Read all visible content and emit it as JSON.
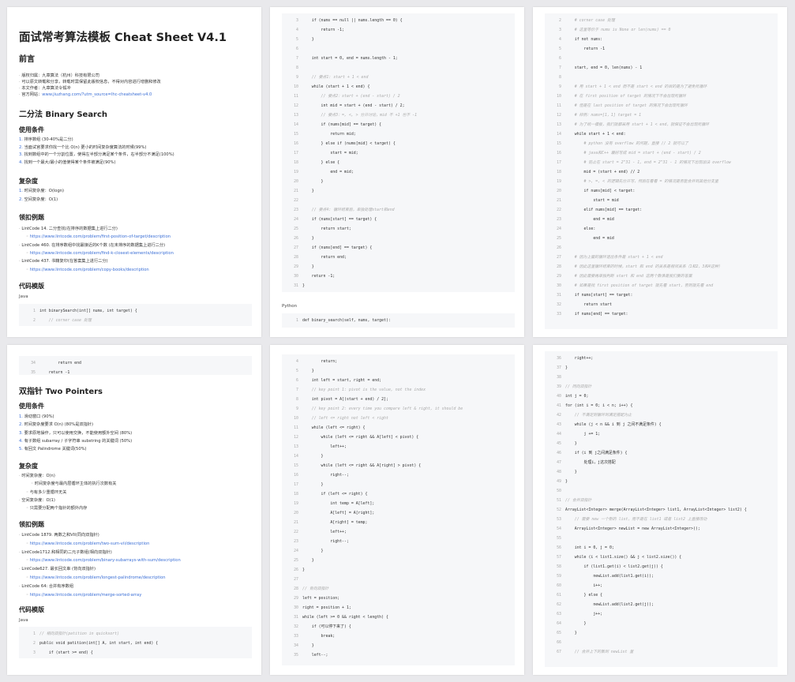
{
  "p1": {
    "title": "面试常考算法模板 Cheat Sheet V4.1",
    "preface": {
      "heading": "前言",
      "items": [
        {
          "t": "版权归属：九章算法（杭州）科技有限公司"
        },
        {
          "t": "可以原文转载和分享，转载时需保留此版权信息，不得对内容进行增删和修改"
        },
        {
          "t": "本文作者：九章算法令狐冲"
        },
        {
          "t": "官方网站：",
          "u": "www.jiuzhang.com/?utm_source=lhc-cheatsheet-v4.0"
        }
      ]
    },
    "section": "二分法 Binary Search",
    "conditions": {
      "heading": "使用条件",
      "items": [
        {
          "n": "1.",
          "t": "排序数组 (30-40%是二分)"
        },
        {
          "n": "2.",
          "t": "当面试官要求你找一个比 O(n) 更小的时间复杂度算法的时候(99%)"
        },
        {
          "n": "3.",
          "t": "找到数组中的一个分割位置，使得左半部分满足某个条件，右半部分不满足(100%)"
        },
        {
          "n": "4.",
          "t": "找到一个最大/最小的值使得某个条件被满足(90%)"
        }
      ]
    },
    "complexity": {
      "heading": "复杂度",
      "items": [
        {
          "n": "1.",
          "t": "时间复杂度：O(logn)"
        },
        {
          "n": "2.",
          "t": "空间复杂度：O(1)"
        }
      ]
    },
    "examples": {
      "heading": "领扣例题",
      "items": [
        {
          "t": "LintCode 14. 二分查找(在排序的数据集上进行二分)",
          "lvl": 0
        },
        {
          "u": "https://www.lintcode.com/problem/first-position-of-target/description",
          "lvl": 1
        },
        {
          "t": "LintCode 460. 在排序数组中找最接近的K个数 (在未排序的数据集上进行二分)",
          "lvl": 0
        },
        {
          "u": "https://www.lintcode.com/problem/find-k-closest-elements/description",
          "lvl": 1
        },
        {
          "t": "LintCode 437. 书籍复印(在答案集上进行二分)",
          "lvl": 0
        },
        {
          "u": "https://www.lintcode.com/problem/copy-books/description",
          "lvl": 1
        }
      ]
    },
    "template_heading": "代码模版",
    "lang": "Java",
    "code": [
      {
        "n": "1",
        "t": "int binarySearch(int[] nums, int target) {"
      },
      {
        "n": "2",
        "t": "    // corner case 处理",
        "c": true
      }
    ]
  },
  "p2": {
    "code": [
      {
        "n": "3",
        "t": "    if (nums == null || nums.length == 0) {"
      },
      {
        "n": "4",
        "t": "        return -1;"
      },
      {
        "n": "5",
        "t": "    }"
      },
      {
        "n": "6",
        "t": ""
      },
      {
        "n": "7",
        "t": "    int start = 0, end = nums.length - 1;"
      },
      {
        "n": "8",
        "t": ""
      },
      {
        "n": "9",
        "t": "    // 要点1: start + 1 < end",
        "c": true
      },
      {
        "n": "10",
        "t": "    while (start + 1 < end) {"
      },
      {
        "n": "11",
        "t": "        // 要点2：start + (end - start) / 2",
        "c": true
      },
      {
        "n": "12",
        "t": "        int mid = start + (end - start) / 2;"
      },
      {
        "n": "13",
        "t": "        // 要点3：=, <, > 分开讨论，mid 不 +1 也不 -1",
        "c": true
      },
      {
        "n": "14",
        "t": "        if (nums[mid] == target) {"
      },
      {
        "n": "15",
        "t": "            return mid;"
      },
      {
        "n": "16",
        "t": "        } else if (nums[mid] < target) {"
      },
      {
        "n": "17",
        "t": "            start = mid;"
      },
      {
        "n": "18",
        "t": "        } else {"
      },
      {
        "n": "19",
        "t": "            end = mid;"
      },
      {
        "n": "20",
        "t": "        }"
      },
      {
        "n": "21",
        "t": "    }"
      },
      {
        "n": "22",
        "t": ""
      },
      {
        "n": "23",
        "t": "    // 要点4: 循环结束后，单独处理start和end",
        "c": true
      },
      {
        "n": "24",
        "t": "    if (nums[start] == target) {"
      },
      {
        "n": "25",
        "t": "        return start;"
      },
      {
        "n": "26",
        "t": "    }"
      },
      {
        "n": "27",
        "t": "    if (nums[end] == target) {"
      },
      {
        "n": "28",
        "t": "        return end;"
      },
      {
        "n": "29",
        "t": "    }"
      },
      {
        "n": "30",
        "t": "    return -1;"
      },
      {
        "n": "31",
        "t": "}"
      }
    ],
    "lang": "Python",
    "code2": [
      {
        "n": "1",
        "t": "def binary_search(self, nums, target):"
      }
    ]
  },
  "p3": {
    "code": [
      {
        "n": "2",
        "t": "    # corner case 处理",
        "c": true
      },
      {
        "n": "3",
        "t": "    # 这里等价于 nums is None or len(nums) == 0",
        "c": true
      },
      {
        "n": "4",
        "t": "    if not nums:"
      },
      {
        "n": "5",
        "t": "        return -1"
      },
      {
        "n": "6",
        "t": ""
      },
      {
        "n": "7",
        "t": "    start, end = 0, len(nums) - 1"
      },
      {
        "n": "8",
        "t": ""
      },
      {
        "n": "9",
        "t": "    # 用 start + 1 < end 而不是 start < end 的目的是为了避免死循环",
        "c": true
      },
      {
        "n": "10",
        "t": "    # 在 first position of target 的情况下不会出现死循环",
        "c": true
      },
      {
        "n": "11",
        "t": "    # 但是在 last position of target 的情况下会出现死循环",
        "c": true
      },
      {
        "n": "12",
        "t": "    # 样例：nums=[1，1] target = 1",
        "c": true
      },
      {
        "n": "13",
        "t": "    # 为了统一模板，我们就都采用 start + 1 < end，就保证不会出现死循环",
        "c": true
      },
      {
        "n": "14",
        "t": "    while start + 1 < end:"
      },
      {
        "n": "15",
        "t": "        # python 没有 overflow 的问题，直接 // 2 就可以了",
        "c": true
      },
      {
        "n": "16",
        "t": "        # java和C++ 最好写成 mid = start + (end - start) / 2",
        "c": true
      },
      {
        "n": "17",
        "t": "        # 防止在 start = 2^31 - 1, end = 2^31 - 1 的情况下出现加法 overflow",
        "c": true
      },
      {
        "n": "18",
        "t": "        mid = (start + end) // 2"
      },
      {
        "n": "19",
        "t": "        # >, =, < 的逻辑先分开写，然后在看看 = 的情况是否能合并到其他分支里",
        "c": true
      },
      {
        "n": "20",
        "t": "        if nums[mid] < target:"
      },
      {
        "n": "21",
        "t": "            start = mid"
      },
      {
        "n": "22",
        "t": "        elif nums[mid] == target:"
      },
      {
        "n": "23",
        "t": "            end = mid"
      },
      {
        "n": "24",
        "t": "        else:"
      },
      {
        "n": "25",
        "t": "            end = mid"
      },
      {
        "n": "26",
        "t": ""
      },
      {
        "n": "27",
        "t": "    # 因为上面的循环退出条件是 start + 1 < end",
        "c": true
      },
      {
        "n": "28",
        "t": "    # 因此这里循环结束的时候，start 和 end 的关系是相邻关系（1和2，3和4这种）",
        "c": true
      },
      {
        "n": "29",
        "t": "    # 因此需要再单独判断 start 和 end 这两个数谁是我们要的答案",
        "c": true
      },
      {
        "n": "30",
        "t": "    # 如果是找 first position of target 就先看 start，否则就先看 end",
        "c": true
      },
      {
        "n": "31",
        "t": "    if nums[start] == target:"
      },
      {
        "n": "32",
        "t": "        return start"
      },
      {
        "n": "33",
        "t": "    if nums[end] == target:"
      }
    ]
  },
  "p4": {
    "code_top": [
      {
        "n": "34",
        "t": "        return end"
      },
      {
        "n": "35",
        "t": "    return -1"
      }
    ],
    "section": "双指针 Two Pointers",
    "conditions": {
      "heading": "使用条件",
      "items": [
        {
          "n": "1.",
          "t": "滑动窗口 (90%)"
        },
        {
          "n": "2.",
          "t": "时间复杂度要求 O(n) (80%是双指针)"
        },
        {
          "n": "3.",
          "t": "要求原地操作，只可以使用交换，不能使用额外空间 (80%)"
        },
        {
          "n": "4.",
          "t": "有子数组 subarray / 子字符串 substring 的关键词 (50%)"
        },
        {
          "n": "5.",
          "t": "有回文 Palindrome 关键词(50%)"
        }
      ]
    },
    "complexity": {
      "heading": "复杂度",
      "items": [
        {
          "t": "时间复杂度：O(n)",
          "lvl": 0
        },
        {
          "t": "时间复杂度与最内层循环主体的执行次数有关",
          "lvl": 2
        },
        {
          "t": "与有多少重循环无关",
          "lvl": 1
        },
        {
          "t": "空间复杂度：O(1)",
          "lvl": 0
        },
        {
          "t": "只需要分配两个指针的额外内存",
          "lvl": 1
        }
      ]
    },
    "examples": {
      "heading": "领扣例题",
      "items": [
        {
          "t": "LintCode 1879. 两数之和VII(同向双指针)",
          "lvl": 0
        },
        {
          "u": "https://www.lintcode.com/problem/two-sum-vii/description",
          "lvl": 1
        },
        {
          "t": "LintCode1712.和相同的二元子数组(相向双指针)",
          "lvl": 0
        },
        {
          "u": "https://www.lintcode.com/problem/binary-subarrays-with-sum/description",
          "lvl": 1
        },
        {
          "t": "LintCode627. 最长回文串 (背向双指针)",
          "lvl": 0
        },
        {
          "u": "https://www.lintcode.com/problem/longest-palindrome/description",
          "lvl": 1
        },
        {
          "t": "LintCode 64: 合并有序数组",
          "lvl": 0
        },
        {
          "u": "https://www.lintcode.com/problem/merge-sorted-array",
          "lvl": 1
        }
      ]
    },
    "template_heading": "代码模版",
    "lang": "Java",
    "code": [
      {
        "n": "1",
        "t": "// 相向双指针(patition in quicksort)",
        "c": true
      },
      {
        "n": "2",
        "t": "public void patition(int[] A, int start, int end) {"
      },
      {
        "n": "3",
        "t": "    if (start >= end) {"
      }
    ]
  },
  "p5": {
    "code": [
      {
        "n": "4",
        "t": "        return;"
      },
      {
        "n": "5",
        "t": "    }"
      },
      {
        "n": "6",
        "t": "    int left = start, right = end;"
      },
      {
        "n": "7",
        "t": "    // key point 1: pivot is the value, not the index",
        "c": true
      },
      {
        "n": "8",
        "t": "    int pivot = A[(start + end) / 2];"
      },
      {
        "n": "9",
        "t": "    // key point 2: every time you compare left & right, it should be",
        "c": true
      },
      {
        "n": "10",
        "t": "    // left <= right not left < right",
        "c": true
      },
      {
        "n": "11",
        "t": "    while (left <= right) {"
      },
      {
        "n": "12",
        "t": "        while (left <= right && A[left] < pivot) {"
      },
      {
        "n": "13",
        "t": "            left++;"
      },
      {
        "n": "14",
        "t": "        }"
      },
      {
        "n": "15",
        "t": "        while (left <= right && A[right] > pivot) {"
      },
      {
        "n": "16",
        "t": "            right--;"
      },
      {
        "n": "17",
        "t": "        }"
      },
      {
        "n": "18",
        "t": "        if (left <= right) {"
      },
      {
        "n": "19",
        "t": "            int temp = A[left];"
      },
      {
        "n": "20",
        "t": "            A[left] = A[right];"
      },
      {
        "n": "21",
        "t": "            A[right] = temp;"
      },
      {
        "n": "22",
        "t": "            left++;"
      },
      {
        "n": "23",
        "t": "            right--;"
      },
      {
        "n": "24",
        "t": "        }"
      },
      {
        "n": "25",
        "t": "    }"
      },
      {
        "n": "26",
        "t": "}"
      },
      {
        "n": "27",
        "t": ""
      },
      {
        "n": "28",
        "t": "// 背向双指针",
        "c": true
      },
      {
        "n": "29",
        "t": "left = position;"
      },
      {
        "n": "30",
        "t": "right = position + 1;"
      },
      {
        "n": "31",
        "t": "while (left >= 0 && right < length) {"
      },
      {
        "n": "32",
        "t": "    if (可以停下来了) {"
      },
      {
        "n": "33",
        "t": "        break;"
      },
      {
        "n": "34",
        "t": "    }"
      },
      {
        "n": "35",
        "t": "    left--;"
      }
    ]
  },
  "p6": {
    "code": [
      {
        "n": "36",
        "t": "    right++;"
      },
      {
        "n": "37",
        "t": "}"
      },
      {
        "n": "38",
        "t": ""
      },
      {
        "n": "39",
        "t": "// 同向双指针",
        "c": true
      },
      {
        "n": "40",
        "t": "int j = 0;"
      },
      {
        "n": "41",
        "t": "for (int i = 0; i < n; i++) {"
      },
      {
        "n": "42",
        "t": "    // 不满足则循环到满足搭配为止",
        "c": true
      },
      {
        "n": "43",
        "t": "    while (j < n && i 到 j 之间不满足条件) {"
      },
      {
        "n": "44",
        "t": "        j += 1;"
      },
      {
        "n": "45",
        "t": "    }"
      },
      {
        "n": "46",
        "t": "    if (i 到 j之间满足条件) {"
      },
      {
        "n": "47",
        "t": "        处理i，j这次搭配"
      },
      {
        "n": "48",
        "t": "    }"
      },
      {
        "n": "49",
        "t": "}"
      },
      {
        "n": "50",
        "t": ""
      },
      {
        "n": "51",
        "t": "// 合并双指针",
        "c": true
      },
      {
        "n": "52",
        "t": "ArrayList<Integer> merge(ArrayList<Integer> list1, ArrayList<Integer> list2) {"
      },
      {
        "n": "53",
        "t": "    // 需要 new 一个新的 list，而不是在 list1 或者 list2 上直接改动",
        "c": true
      },
      {
        "n": "54",
        "t": "    ArrayList<Integer> newList = new ArrayList<Integer>();"
      },
      {
        "n": "55",
        "t": ""
      },
      {
        "n": "56",
        "t": "    int i = 0, j = 0;"
      },
      {
        "n": "57",
        "t": "    while (i < list1.size() && j < list2.size()) {"
      },
      {
        "n": "58",
        "t": "        if (list1.get(i) < list2.get(j)) {"
      },
      {
        "n": "59",
        "t": "            newList.add(list1.get(i));"
      },
      {
        "n": "60",
        "t": "            i++;"
      },
      {
        "n": "61",
        "t": "        } else {"
      },
      {
        "n": "62",
        "t": "            newList.add(list2.get(j));"
      },
      {
        "n": "63",
        "t": "            j++;"
      },
      {
        "n": "64",
        "t": "        }"
      },
      {
        "n": "65",
        "t": "    }"
      },
      {
        "n": "66",
        "t": ""
      },
      {
        "n": "67",
        "t": "    // 合并上下的数到 newList 里",
        "c": true
      }
    ]
  }
}
